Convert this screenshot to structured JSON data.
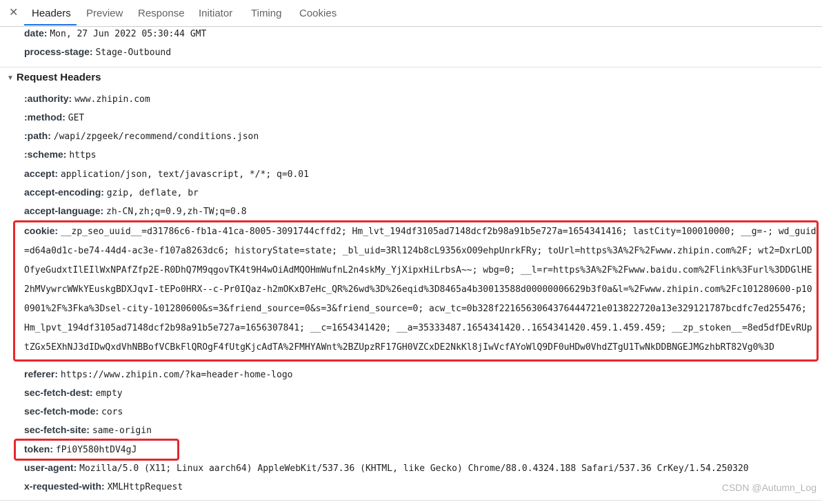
{
  "tabs": [
    {
      "label": "Headers"
    },
    {
      "label": "Preview"
    },
    {
      "label": "Response"
    },
    {
      "label": "Initiator"
    },
    {
      "label": "Timing"
    },
    {
      "label": "Cookies"
    }
  ],
  "close_glyph": "✕",
  "response_headers_tail": [
    {
      "name": "date:",
      "value": "Mon, 27 Jun 2022 05:30:44 GMT"
    },
    {
      "name": "process-stage:",
      "value": "Stage-Outbound"
    }
  ],
  "request_section": {
    "title": "Request Headers",
    "toggle_glyph": "▼"
  },
  "request_headers": [
    {
      "name": ":authority:",
      "value": "www.zhipin.com"
    },
    {
      "name": ":method:",
      "value": "GET"
    },
    {
      "name": ":path:",
      "value": "/wapi/zpgeek/recommend/conditions.json"
    },
    {
      "name": ":scheme:",
      "value": "https"
    },
    {
      "name": "accept:",
      "value": "application/json, text/javascript, */*; q=0.01"
    },
    {
      "name": "accept-encoding:",
      "value": "gzip, deflate, br"
    },
    {
      "name": "accept-language:",
      "value": "zh-CN,zh;q=0.9,zh-TW;q=0.8"
    }
  ],
  "cookie": {
    "name": "cookie:",
    "value": "__zp_seo_uuid__=d31786c6-fb1a-41ca-8005-3091744cffd2; Hm_lvt_194df3105ad7148dcf2b98a91b5e727a=1654341416; lastCity=100010000; __g=-; wd_guid=d64a0d1c-be74-44d4-ac3e-f107a8263dc6; historyState=state; _bl_uid=3Rl124b8cL9356xO09ehpUnrkFRy; toUrl=https%3A%2F%2Fwww.zhipin.com%2F; wt2=DxrLODOfyeGudxtIlEIlWxNPAfZfp2E-R0DhQ7M9qgovTK4t9H4wOiAdMQOHmWufnL2n4skMy_YjXipxHiLrbsA~~; wbg=0; __l=r=https%3A%2F%2Fwww.baidu.com%2Flink%3Furl%3DDGlHE2hMVywrcWWkYEuskgBDXJqvI-tEPo0HRX--c-Pr0IQaz-h2mOKxB7eHc_QR%26wd%3D%26eqid%3D8465a4b30013588d00000006629b3f0a&l=%2Fwww.zhipin.com%2Fc101280600-p100901%2F%3Fka%3Dsel-city-101280600&s=3&friend_source=0&s=3&friend_source=0; acw_tc=0b328f2216563064376444721e013822720a13e329121787bcdfc7ed255476; Hm_lpvt_194df3105ad7148dcf2b98a91b5e727a=1656307841; __c=1654341420; __a=35333487.1654341420..1654341420.459.1.459.459; __zp_stoken__=8ed5dfDEvRUptZGx5EXhNJ3dIDwQxdVhNBBofVCBkFlQROgF4fUtgKjcAdTA%2FMHYAWnt%2BZUpzRF17GH0VZCxDE2NkKl8jIwVcfAYoWlQ9DF0uHDw0VhdZTgU1TwNkDDBNGEJMGzhbRT82Vg0%3D"
  },
  "request_headers_after": [
    {
      "name": "referer:",
      "value": "https://www.zhipin.com/?ka=header-home-logo"
    },
    {
      "name": "sec-fetch-dest:",
      "value": "empty"
    },
    {
      "name": "sec-fetch-mode:",
      "value": "cors"
    },
    {
      "name": "sec-fetch-site:",
      "value": "same-origin"
    },
    {
      "name": "token:",
      "value": "fPi0Y580htDV4gJ"
    },
    {
      "name": "user-agent:",
      "value": "Mozilla/5.0 (X11; Linux aarch64) AppleWebKit/537.36 (KHTML, like Gecko) Chrome/88.0.4324.188 Safari/537.36 CrKey/1.54.250320"
    },
    {
      "name": "x-requested-with:",
      "value": "XMLHttpRequest"
    }
  ],
  "watermark": "CSDN @Autumn_Log",
  "colors": {
    "highlight": "#e8262b",
    "active_tab_underline": "#1a73e8"
  }
}
